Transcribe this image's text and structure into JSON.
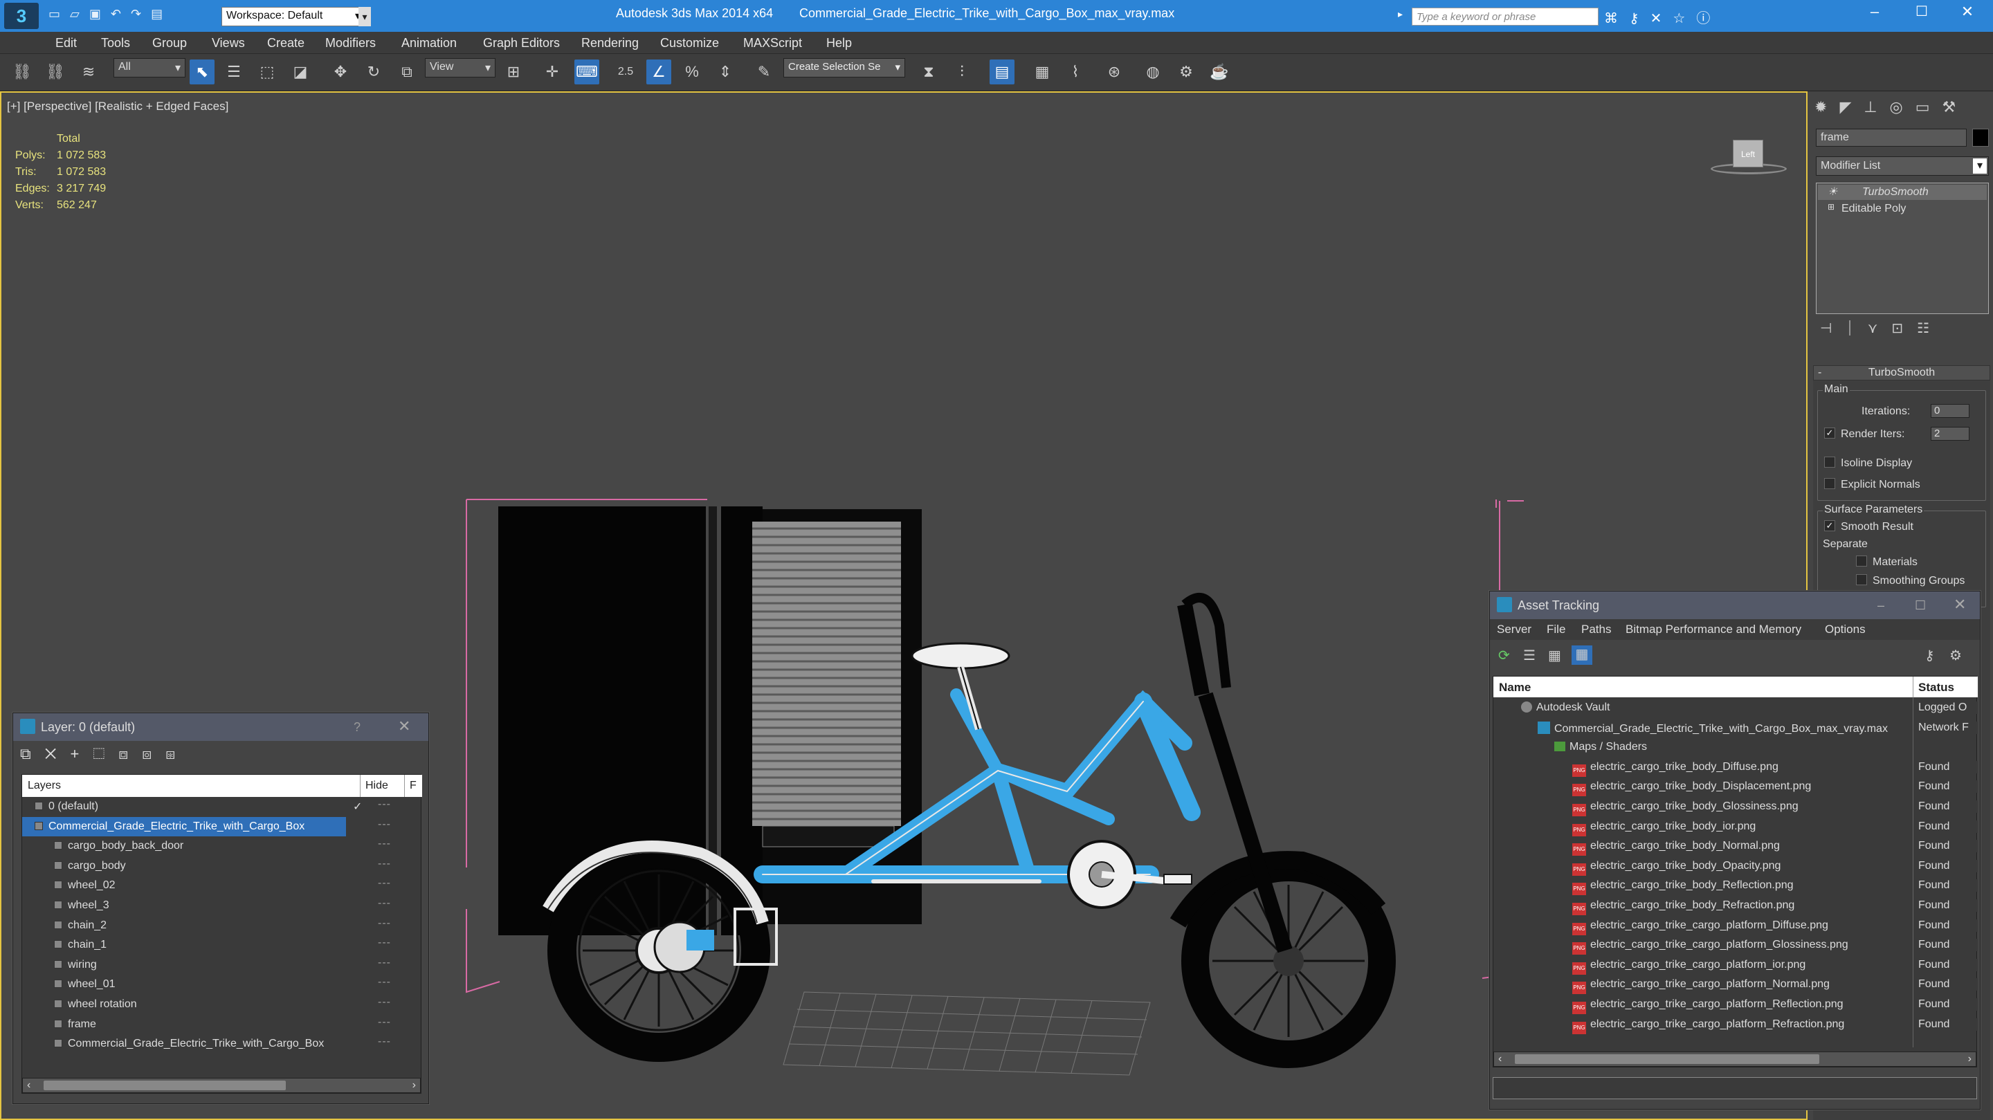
{
  "app": {
    "title": "Autodesk 3ds Max  2014 x64",
    "file": "Commercial_Grade_Electric_Trike_with_Cargo_Box_max_vray.max",
    "workspace": "Workspace: Default",
    "search_placeholder": "Type a keyword or phrase"
  },
  "menu": [
    "Edit",
    "Tools",
    "Group",
    "Views",
    "Create",
    "Modifiers",
    "Animation",
    "Graph Editors",
    "Rendering",
    "Customize",
    "MAXScript",
    "Help"
  ],
  "toolbar": {
    "filter": "All",
    "ref_coord": "View",
    "selection_set": "Create Selection Se",
    "snap_value": "2.5"
  },
  "viewport": {
    "label": "[+] [Perspective] [Realistic + Edged Faces]",
    "stats_header": "Total",
    "stats": [
      {
        "k": "Polys:",
        "v": "1 072 583"
      },
      {
        "k": "Tris:",
        "v": "1 072 583"
      },
      {
        "k": "Edges:",
        "v": "3 217 749"
      },
      {
        "k": "Verts:",
        "v": "562 247"
      }
    ],
    "viewcube": "Left"
  },
  "command_panel": {
    "object_name": "frame",
    "modifier_list": "Modifier List",
    "stack": [
      {
        "label": "TurboSmooth",
        "italic": true
      },
      {
        "label": "Editable Poly",
        "italic": false
      }
    ],
    "rollout_title": "TurboSmooth",
    "main_group": "Main",
    "iterations_label": "Iterations:",
    "iterations_value": "0",
    "render_iters_label": "Render Iters:",
    "render_iters_value": "2",
    "isoline": "Isoline Display",
    "explicit": "Explicit Normals",
    "surface_group": "Surface Parameters",
    "smooth_result": "Smooth Result",
    "separate": "Separate",
    "materials": "Materials",
    "smoothing_groups": "Smoothing Groups"
  },
  "layer_panel": {
    "title": "Layer: 0 (default)",
    "help": "?",
    "col_layers": "Layers",
    "col_hide": "Hide",
    "col_f": "F",
    "rows": [
      {
        "label": "0 (default)",
        "level": 1,
        "selected": false,
        "check": "✓"
      },
      {
        "label": "Commercial_Grade_Electric_Trike_with_Cargo_Box",
        "level": 1,
        "selected": true,
        "check": ""
      },
      {
        "label": "cargo_body_back_door",
        "level": 2,
        "selected": false,
        "check": ""
      },
      {
        "label": "cargo_body",
        "level": 2,
        "selected": false,
        "check": ""
      },
      {
        "label": "wheel_02",
        "level": 2,
        "selected": false,
        "check": ""
      },
      {
        "label": "wheel_3",
        "level": 2,
        "selected": false,
        "check": ""
      },
      {
        "label": "chain_2",
        "level": 2,
        "selected": false,
        "check": ""
      },
      {
        "label": "chain_1",
        "level": 2,
        "selected": false,
        "check": ""
      },
      {
        "label": "wiring",
        "level": 2,
        "selected": false,
        "check": ""
      },
      {
        "label": "wheel_01",
        "level": 2,
        "selected": false,
        "check": ""
      },
      {
        "label": "wheel rotation",
        "level": 2,
        "selected": false,
        "check": ""
      },
      {
        "label": "frame",
        "level": 2,
        "selected": false,
        "check": ""
      },
      {
        "label": "Commercial_Grade_Electric_Trike_with_Cargo_Box",
        "level": 2,
        "selected": false,
        "check": ""
      }
    ]
  },
  "asset_panel": {
    "title": "Asset Tracking",
    "menu": [
      "Server",
      "File",
      "Paths",
      "Bitmap Performance and Memory",
      "Options"
    ],
    "col_name": "Name",
    "col_status": "Status",
    "rows": [
      {
        "name": "Autodesk Vault",
        "level": 1,
        "status": "Logged O",
        "type": "vault"
      },
      {
        "name": "Commercial_Grade_Electric_Trike_with_Cargo_Box_max_vray.max",
        "level": 2,
        "status": "Network F",
        "type": "max"
      },
      {
        "name": "Maps / Shaders",
        "level": 3,
        "status": "",
        "type": "folder"
      },
      {
        "name": "electric_cargo_trike_body_Diffuse.png",
        "level": 4,
        "status": "Found",
        "type": "png"
      },
      {
        "name": "electric_cargo_trike_body_Displacement.png",
        "level": 4,
        "status": "Found",
        "type": "png"
      },
      {
        "name": "electric_cargo_trike_body_Glossiness.png",
        "level": 4,
        "status": "Found",
        "type": "png"
      },
      {
        "name": "electric_cargo_trike_body_ior.png",
        "level": 4,
        "status": "Found",
        "type": "png"
      },
      {
        "name": "electric_cargo_trike_body_Normal.png",
        "level": 4,
        "status": "Found",
        "type": "png"
      },
      {
        "name": "electric_cargo_trike_body_Opacity.png",
        "level": 4,
        "status": "Found",
        "type": "png"
      },
      {
        "name": "electric_cargo_trike_body_Reflection.png",
        "level": 4,
        "status": "Found",
        "type": "png"
      },
      {
        "name": "electric_cargo_trike_body_Refraction.png",
        "level": 4,
        "status": "Found",
        "type": "png"
      },
      {
        "name": "electric_cargo_trike_cargo_platform_Diffuse.png",
        "level": 4,
        "status": "Found",
        "type": "png"
      },
      {
        "name": "electric_cargo_trike_cargo_platform_Glossiness.png",
        "level": 4,
        "status": "Found",
        "type": "png"
      },
      {
        "name": "electric_cargo_trike_cargo_platform_ior.png",
        "level": 4,
        "status": "Found",
        "type": "png"
      },
      {
        "name": "electric_cargo_trike_cargo_platform_Normal.png",
        "level": 4,
        "status": "Found",
        "type": "png"
      },
      {
        "name": "electric_cargo_trike_cargo_platform_Reflection.png",
        "level": 4,
        "status": "Found",
        "type": "png"
      },
      {
        "name": "electric_cargo_trike_cargo_platform_Refraction.png",
        "level": 4,
        "status": "Found",
        "type": "png"
      }
    ]
  },
  "colors": {
    "accent": "#2c84d6",
    "frame_blue": "#3aa7e6",
    "viewport_border": "#e5c542",
    "selection": "#2f6fb8"
  }
}
